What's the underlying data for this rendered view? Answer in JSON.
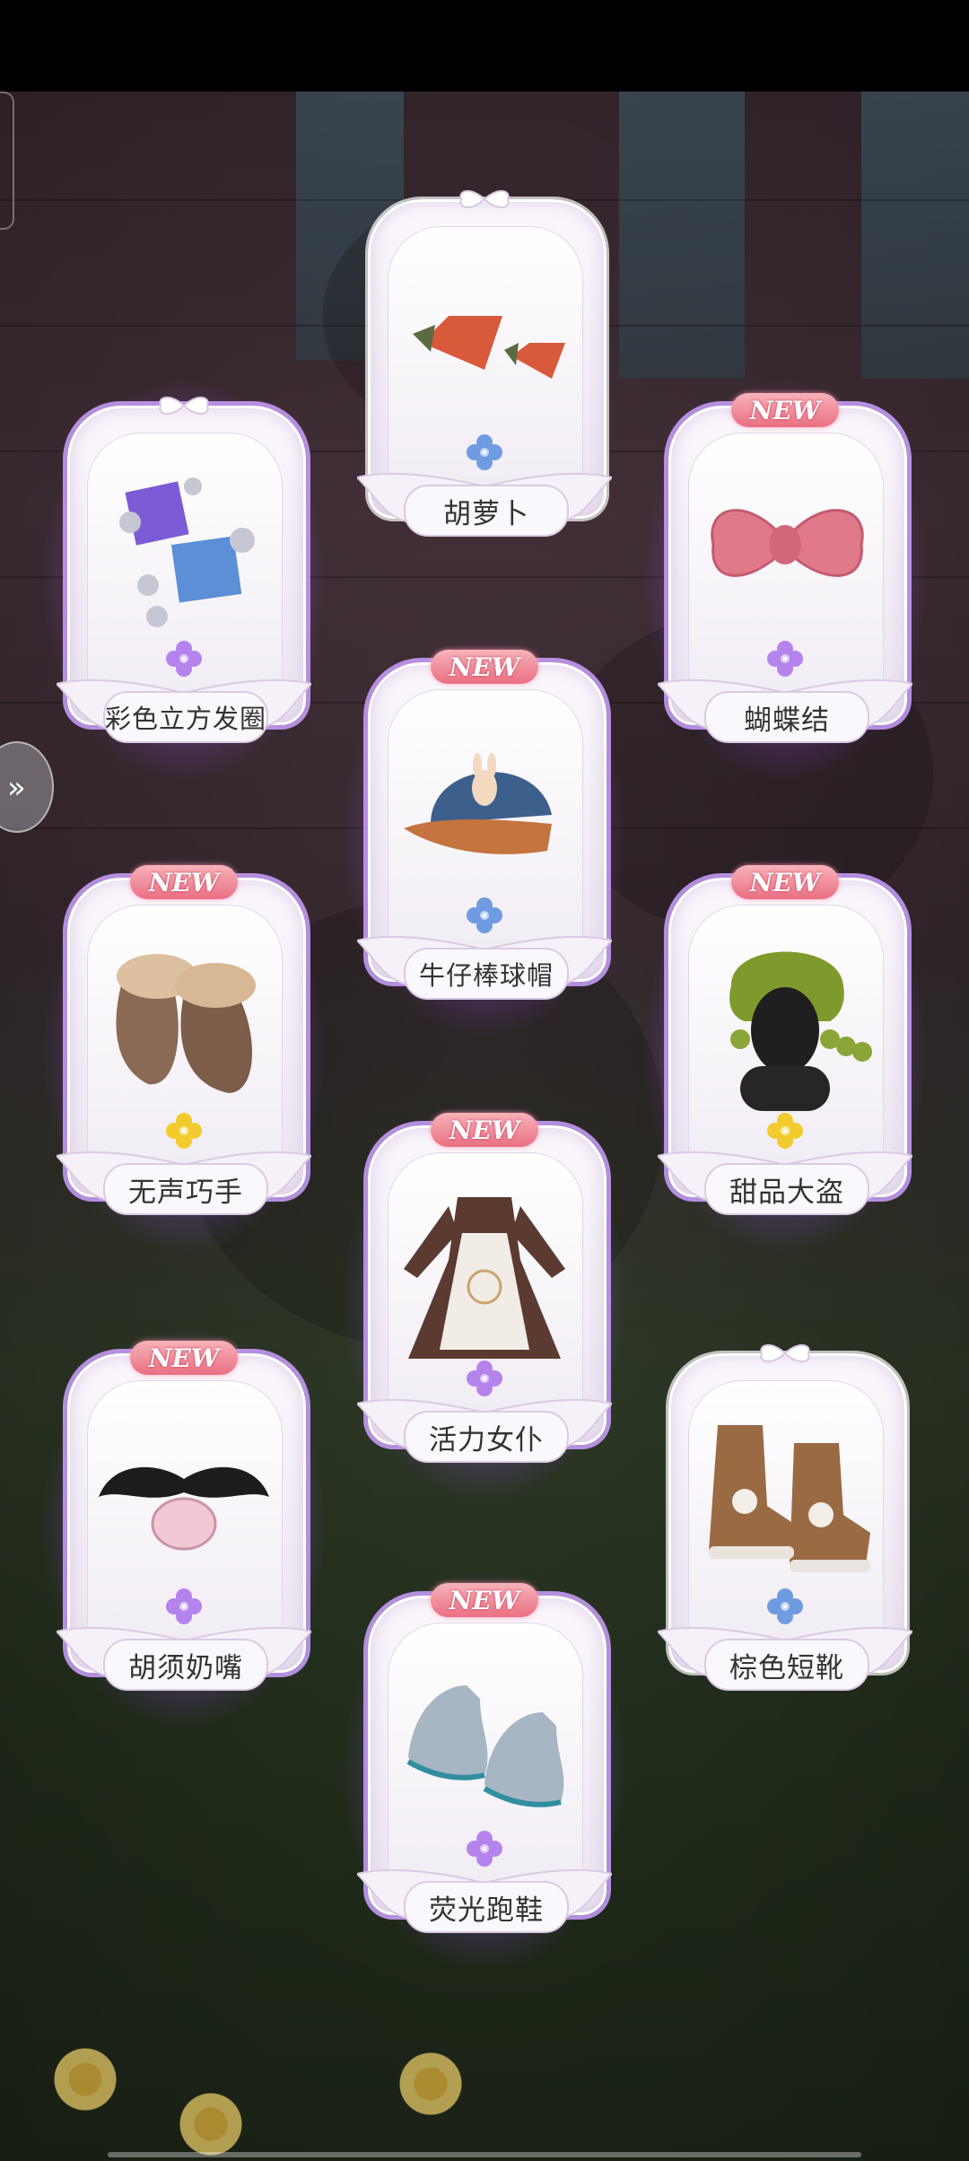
{
  "items": [
    {
      "name": "胡萝卜",
      "new": false,
      "rarity": "blue",
      "icon": "carrot-hairclip-icon"
    },
    {
      "name": "彩色立方发圈",
      "new": false,
      "rarity": "purple",
      "icon": "cube-hairtie-icon"
    },
    {
      "name": "蝴蝶结",
      "new": true,
      "rarity": "purple",
      "icon": "pink-bow-icon"
    },
    {
      "name": "牛仔棒球帽",
      "new": true,
      "rarity": "blue",
      "icon": "denim-cap-icon"
    },
    {
      "name": "无声巧手",
      "new": true,
      "rarity": "gold",
      "icon": "fur-gloves-icon"
    },
    {
      "name": "甜品大盗",
      "new": true,
      "rarity": "gold",
      "icon": "green-hair-icon"
    },
    {
      "name": "活力女仆",
      "new": true,
      "rarity": "purple",
      "icon": "maid-dress-icon"
    },
    {
      "name": "胡须奶嘴",
      "new": true,
      "rarity": "purple",
      "icon": "mustache-pacifier-icon"
    },
    {
      "name": "棕色短靴",
      "new": false,
      "rarity": "blue",
      "icon": "brown-boots-icon"
    },
    {
      "name": "荧光跑鞋",
      "new": true,
      "rarity": "purple",
      "icon": "glow-sneakers-icon"
    }
  ],
  "new_label": "NEW",
  "colors": {
    "blue": "#6f9be0",
    "purple": "#b483ec",
    "gold": "#f2cc2e",
    "glow": "#b97cff"
  },
  "side_button_icon": "double-chevron-right-icon"
}
